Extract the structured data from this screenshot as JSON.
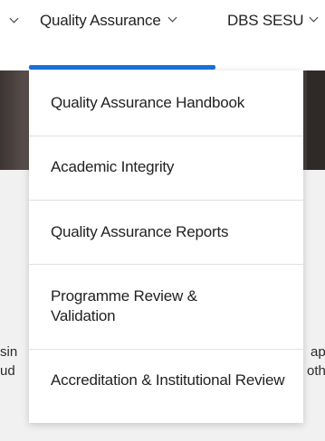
{
  "nav": {
    "items": [
      {
        "label": "Quality Assurance"
      },
      {
        "label": "DBS SESU"
      }
    ],
    "accent_color": "#1a73d9"
  },
  "dropdown": {
    "items": [
      {
        "label": "Quality Assurance Handbook"
      },
      {
        "label": "Academic Integrity"
      },
      {
        "label": "Quality Assurance Reports"
      },
      {
        "label": "Programme Review & Validation"
      },
      {
        "label": "Accreditation & Institutional Review"
      }
    ]
  },
  "background": {
    "line1_left": "sin",
    "line1_right": "app",
    "line2_left": "ud",
    "line2_right": "oth"
  }
}
